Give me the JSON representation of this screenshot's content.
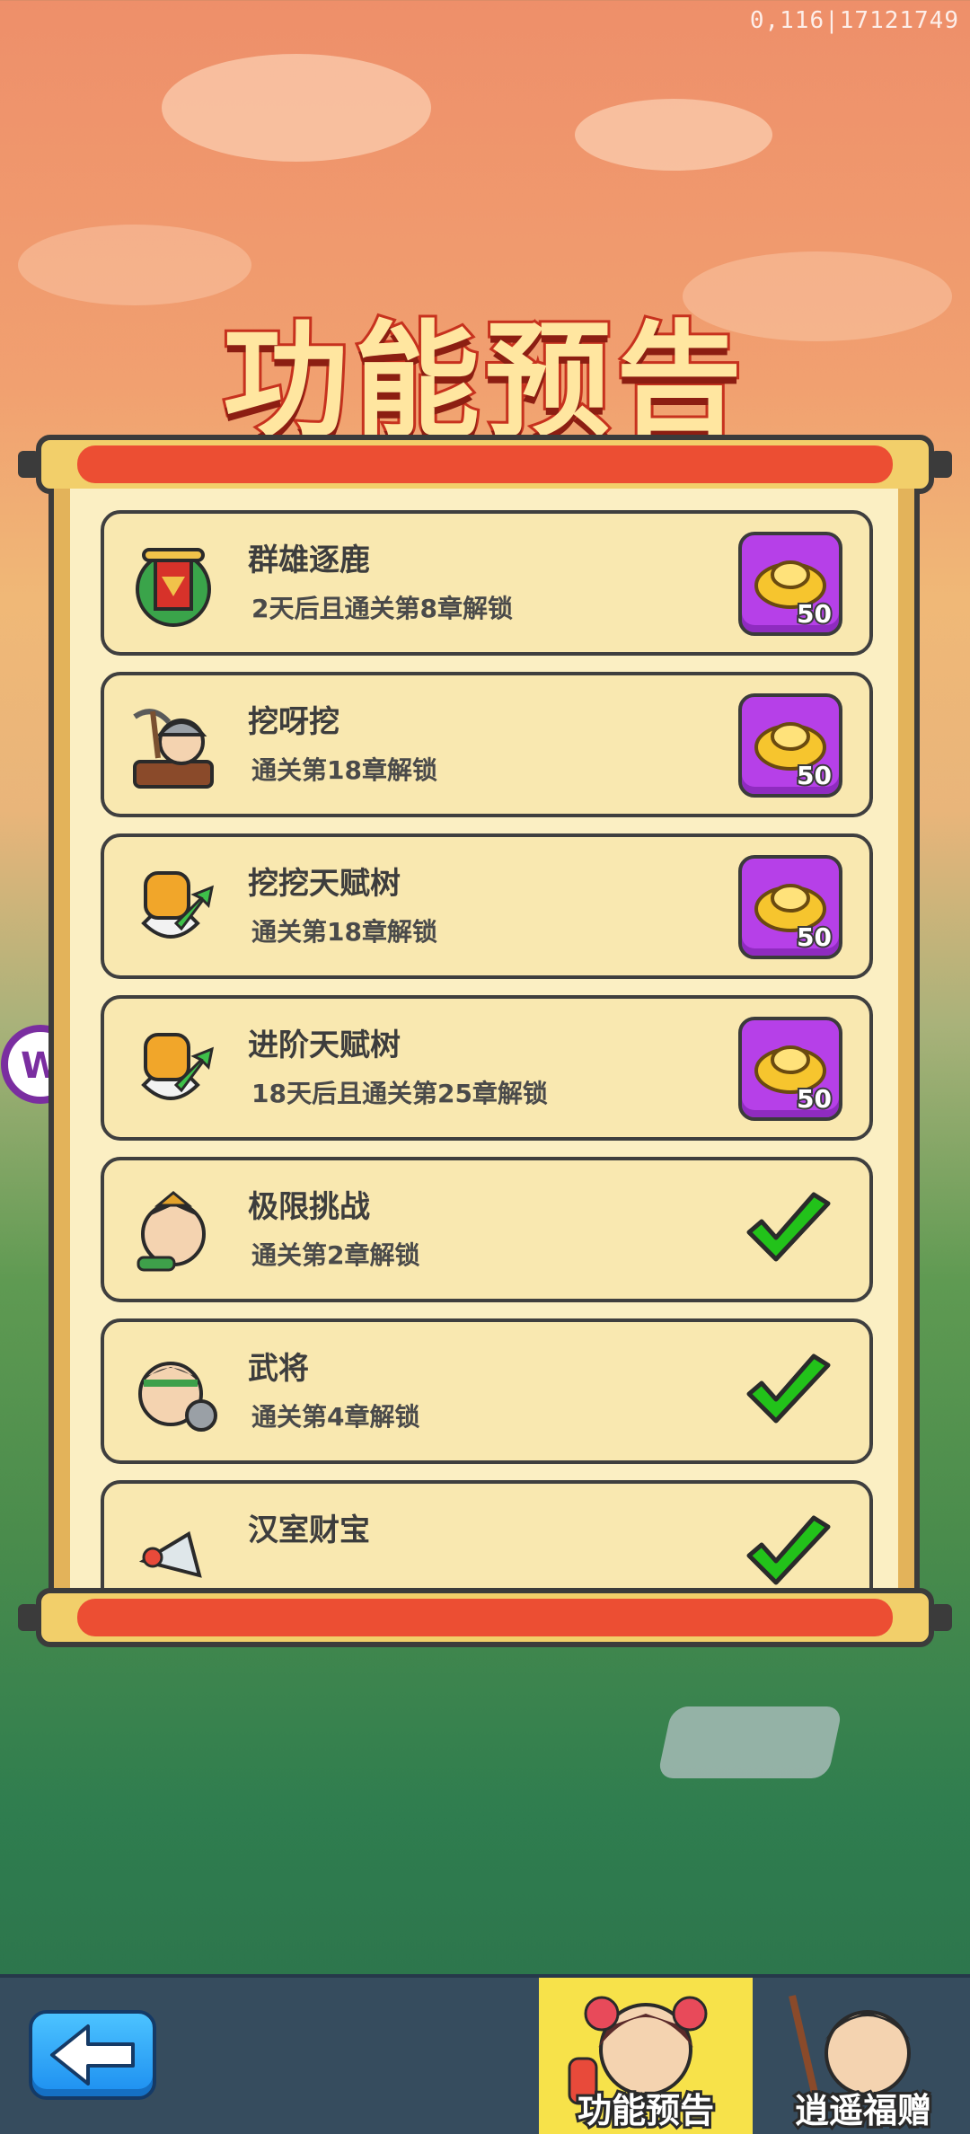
{
  "build_id": "0,116|17121749",
  "title": "功能预告",
  "features": [
    {
      "name": "群雄逐鹿",
      "condition": "2天后且通关第8章解锁",
      "icon": "banner-shield-icon",
      "status": "reward",
      "reward_amount": "50"
    },
    {
      "name": "挖呀挖",
      "condition": "通关第18章解锁",
      "icon": "miner-icon",
      "status": "reward",
      "reward_amount": "50"
    },
    {
      "name": "挖挖天赋树",
      "condition": "通关第18章解锁",
      "icon": "talent-fist-icon",
      "status": "reward",
      "reward_amount": "50"
    },
    {
      "name": "进阶天赋树",
      "condition": "18天后且通关第25章解锁",
      "icon": "talent-fist-icon",
      "status": "reward",
      "reward_amount": "50"
    },
    {
      "name": "极限挑战",
      "condition": "通关第2章解锁",
      "icon": "warrior-face-icon",
      "status": "unlocked"
    },
    {
      "name": "武将",
      "condition": "通关第4章解锁",
      "icon": "general-face-icon",
      "status": "unlocked"
    },
    {
      "name": "汉室财宝",
      "condition": "",
      "icon": "treasure-horn-icon",
      "status": "unlocked"
    }
  ],
  "bottom_bar": {
    "back_icon": "arrow-left-icon",
    "tabs": [
      {
        "label": "功能预告",
        "icon": "girl-portrait-icon",
        "active": true
      },
      {
        "label": "逍遥福赠",
        "icon": "scholar-portrait-icon",
        "active": false
      }
    ]
  },
  "colors": {
    "reward_button": "#b640e8",
    "check": "#22c21a",
    "active_tab": "#f7e24a",
    "title_fill": "#ffe6a0",
    "title_stroke": "#c7321e"
  }
}
